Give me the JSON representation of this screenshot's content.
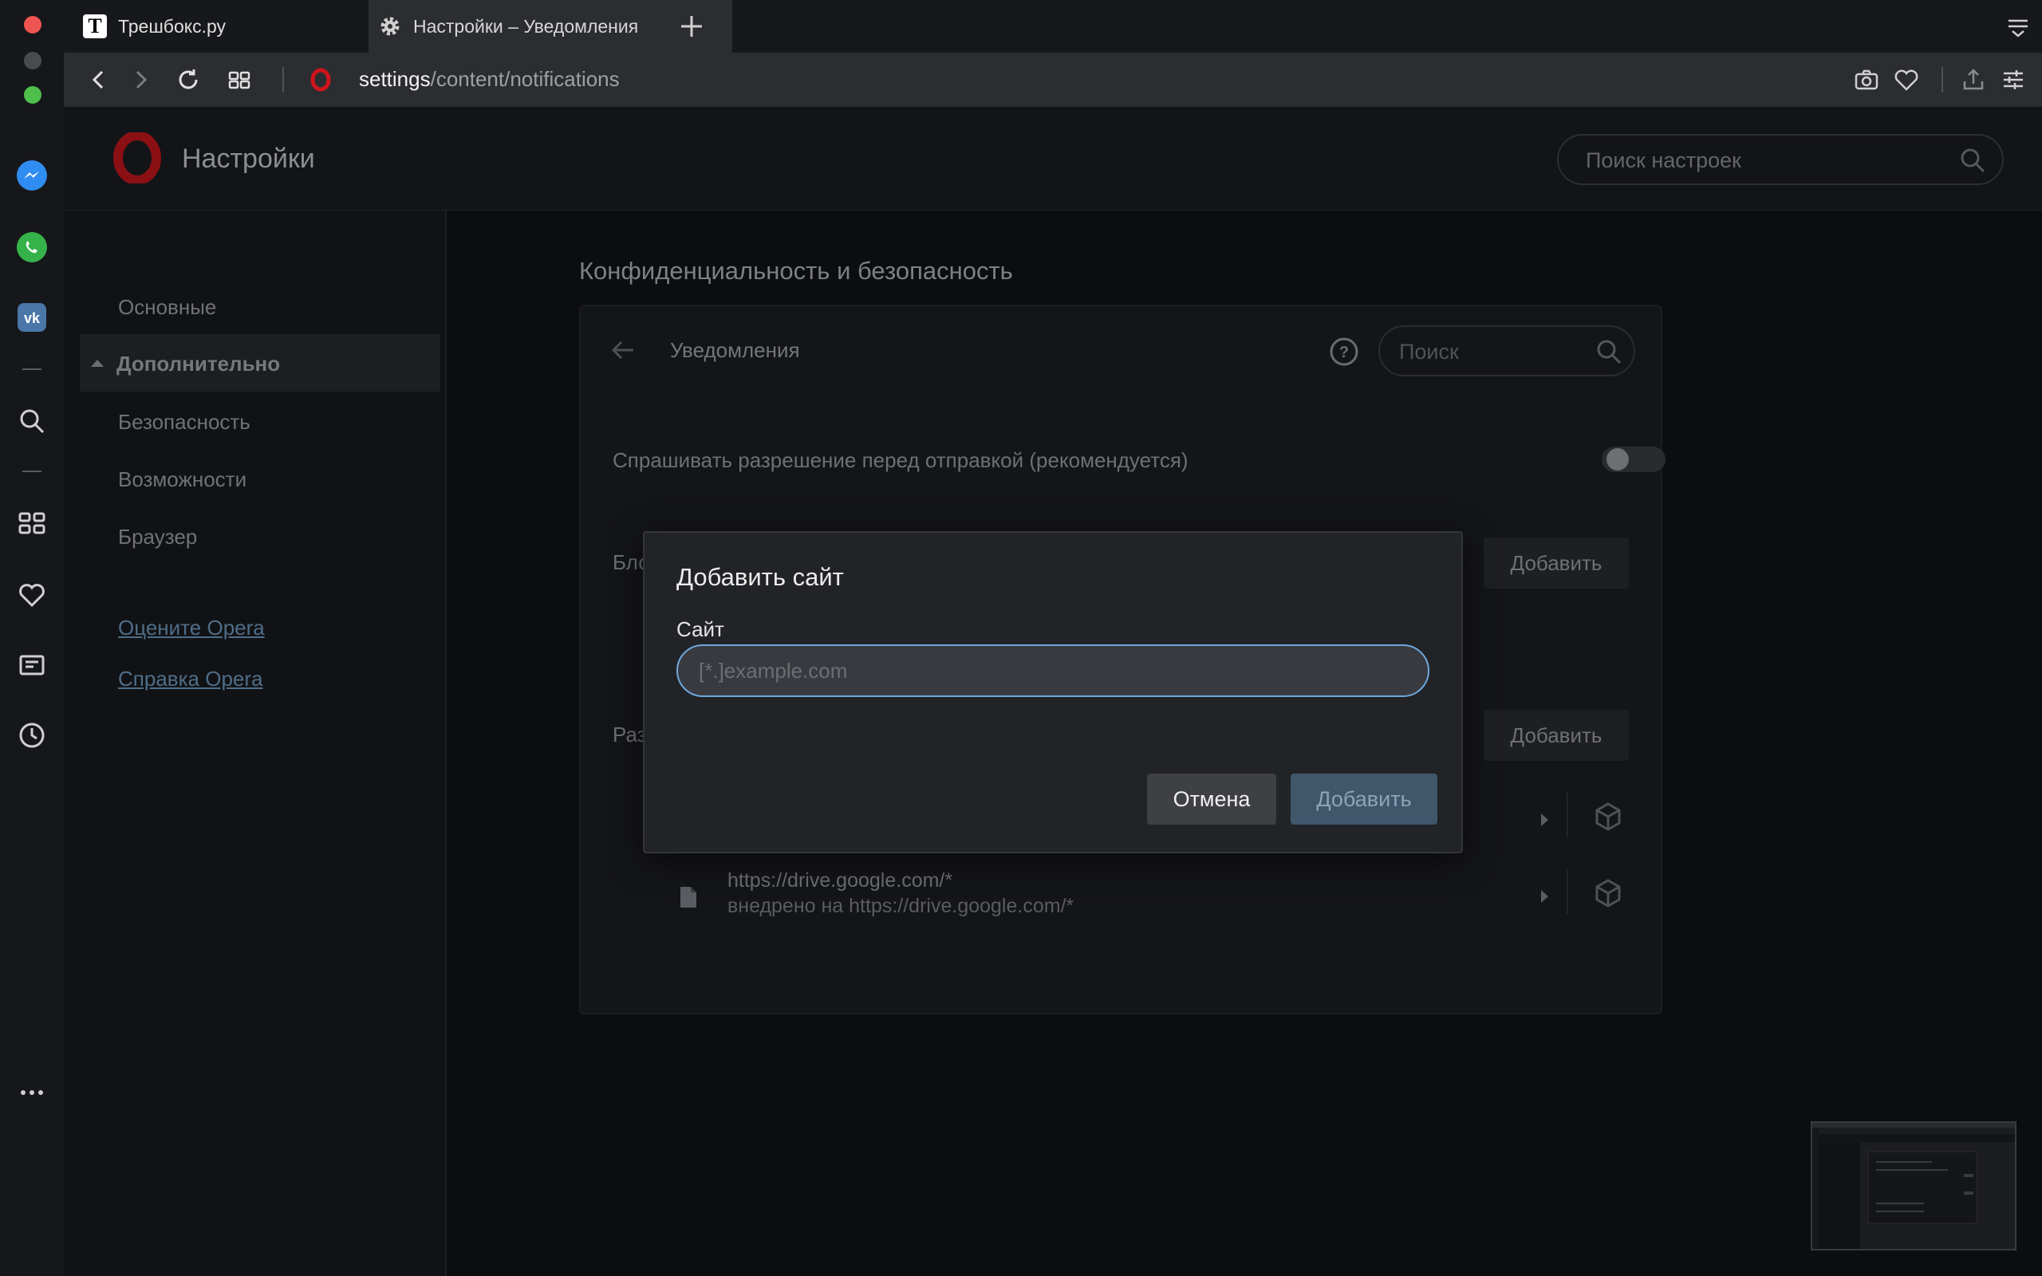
{
  "tabs": [
    {
      "label": "Трешбокс.ру",
      "favicon": "T"
    },
    {
      "label": "Настройки – Уведомления"
    }
  ],
  "address": {
    "host": "settings",
    "path": "/content/notifications"
  },
  "settings_header": {
    "title": "Настройки",
    "search_placeholder": "Поиск настроек"
  },
  "nav": {
    "items": [
      "Основные",
      "Дополнительно",
      "Безопасность",
      "Возможности",
      "Браузер"
    ],
    "links": [
      "Оцените Opera",
      "Справка Opera"
    ]
  },
  "main": {
    "section_title": "Конфиденциальность и безопасность",
    "card_title": "Уведомления",
    "search_placeholder": "Поиск",
    "ask_label": "Спрашивать разрешение перед отправкой (рекомендуется)",
    "block_label_partial": "Бло",
    "allow_label_partial": "Раз",
    "add_label": "Добавить",
    "rows": [
      {
        "line1": "https://drive.google.com/*",
        "line2": "внедрено на https://drive.google.com/*"
      }
    ]
  },
  "dialog": {
    "title": "Добавить сайт",
    "field_label": "Сайт",
    "placeholder": "[*.]example.com",
    "cancel": "Отмена",
    "confirm": "Добавить"
  },
  "colors": {
    "accent": "#6fa8dc",
    "opera_red": "#c7161b"
  }
}
